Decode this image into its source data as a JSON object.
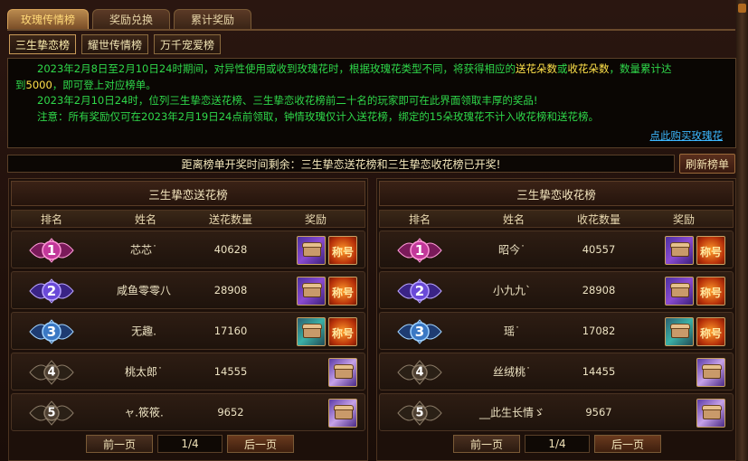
{
  "tabs": [
    {
      "label": "玫瑰传情榜",
      "active": true
    },
    {
      "label": "奖励兑换",
      "active": false
    },
    {
      "label": "累计奖励",
      "active": false
    }
  ],
  "subtabs": [
    {
      "label": "三生挚恋榜",
      "active": true
    },
    {
      "label": "耀世传情榜",
      "active": false
    },
    {
      "label": "万千宠爱榜",
      "active": false
    }
  ],
  "notice": {
    "line1_parts": [
      "2023年2月8日至2月10日24时期间，对异性使用或收到玫瑰花时，根据玫瑰花类型不同，将获得相应的",
      "送花朵数",
      "或",
      "收花朵数",
      "，数量累计达"
    ],
    "line2_parts": [
      "到",
      "5000",
      "，即可登上对应榜单。"
    ],
    "line3": "2023年2月10日24时，位列三生挚恋送花榜、三生挚恋收花榜前二十名的玩家即可在此界面领取丰厚的奖品!",
    "line4": "注意：所有奖励仅可在2023年2月19日24点前领取，钟情玫瑰仅计入送花榜，绑定的15朵玫瑰花不计入收花榜和送花榜。",
    "buy_link": "点此购买玫瑰花"
  },
  "countdown": "距离榜单开奖时间剩余：三生挚恋送花榜和三生挚恋收花榜已开奖!",
  "refresh_label": "刷新榜单",
  "left_panel": {
    "title": "三生挚恋送花榜",
    "headers": {
      "rank": "排名",
      "name": "姓名",
      "count": "送花数量",
      "reward": "奖励"
    },
    "rows": [
      {
        "rank": "1",
        "name": "芯芯˙",
        "count": "40628"
      },
      {
        "rank": "2",
        "name": "咸鱼零零八",
        "count": "28908"
      },
      {
        "rank": "3",
        "name": "无趣.",
        "count": "17160"
      },
      {
        "rank": "4",
        "name": "桃太郎˙",
        "count": "14555"
      },
      {
        "rank": "5",
        "name": "ャ.筱筱.",
        "count": "9652"
      }
    ]
  },
  "right_panel": {
    "title": "三生挚恋收花榜",
    "headers": {
      "rank": "排名",
      "name": "姓名",
      "count": "收花数量",
      "reward": "奖励"
    },
    "rows": [
      {
        "rank": "1",
        "name": "昭今˙",
        "count": "40557"
      },
      {
        "rank": "2",
        "name": "小九九ˋ",
        "count": "28908"
      },
      {
        "rank": "3",
        "name": "瑶˙",
        "count": "17082"
      },
      {
        "rank": "4",
        "name": "丝绒桃˙",
        "count": "14455"
      },
      {
        "rank": "5",
        "name": "__此生长情ゞ",
        "count": "9567"
      }
    ]
  },
  "scroll_reward_text": "称号",
  "pager": {
    "prev": "前一页",
    "page": "1/4",
    "next": "后一页"
  },
  "colors": {
    "green": "#2fd84a",
    "yellow": "#ffe14a",
    "link": "#3cb8ff",
    "gold_tab": "#ffd877"
  }
}
